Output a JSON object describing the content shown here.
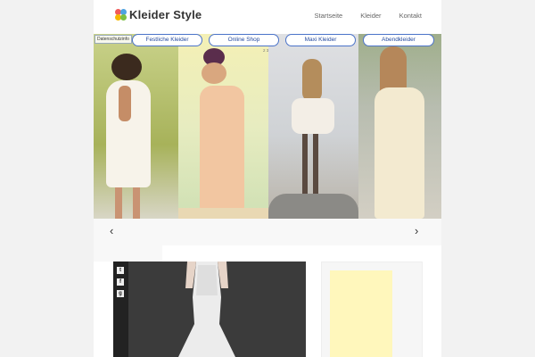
{
  "header": {
    "logo_text": "Kleider Style",
    "nav": [
      {
        "label": "Startseite"
      },
      {
        "label": "Kleider"
      },
      {
        "label": "Kontakt"
      }
    ]
  },
  "banner": {
    "privacy_label": "Datenschutzinfo",
    "pills": [
      {
        "label": "Festliche Kleider"
      },
      {
        "label": "Online Shop"
      },
      {
        "label": "Maxi Kleider"
      },
      {
        "label": "Abendkleider"
      }
    ],
    "pager_text": "2 3"
  },
  "slider": {
    "prev_icon": "chevron-left-icon",
    "next_icon": "chevron-right-icon",
    "prev_glyph": "‹",
    "next_glyph": "›"
  },
  "share": {
    "icons": [
      {
        "name": "twitter-icon",
        "glyph": "t"
      },
      {
        "name": "facebook-icon",
        "glyph": "f"
      },
      {
        "name": "google-plus-icon",
        "glyph": "g"
      }
    ]
  },
  "colors": {
    "pill_border": "#4b73c9",
    "ad_block": "#fff7bc",
    "featured_bg": "#3b3b3b"
  }
}
